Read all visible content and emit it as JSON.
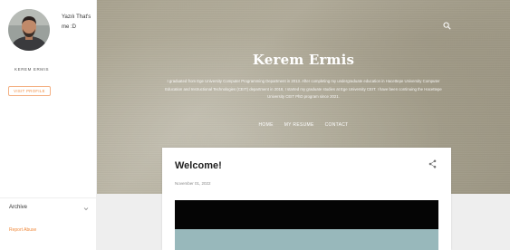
{
  "profile": {
    "bio": "Yazılı That's me :D",
    "name": "KEREM ERMIS",
    "visit_profile_label": "VISIT PROFILE"
  },
  "sidebar": {
    "archive_label": "Archive",
    "report_abuse_label": "Report Abuse"
  },
  "header": {
    "title": "Kerem Ermis",
    "description": "I graduated from Ege University Computer Programming Department in 2013. After completing my undergraduate education in Hacettepe University Computer Education and Instructional Technologies (CEIT) department in 2018, I started my graduate studies at Ege University CEIT. I have been continuing the Hacettepe University CEIT PhD program since 2021.",
    "nav": [
      "HOME",
      "MY RESUME",
      "CONTACT"
    ]
  },
  "post": {
    "title": "Welcome!",
    "date": "November 01, 2022"
  },
  "colors": {
    "accent": "#f08a3d",
    "banner": "#b1ac9a",
    "page_bg": "#eeeeee"
  },
  "icons": [
    "search-icon",
    "share-icon",
    "chevron-down-icon"
  ]
}
